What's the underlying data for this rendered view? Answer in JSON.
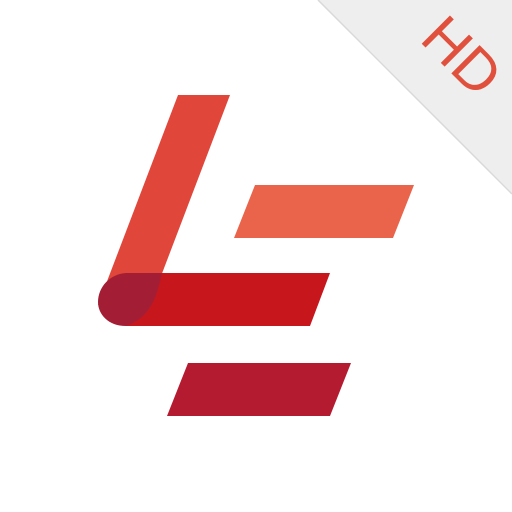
{
  "badge": {
    "label": "HD"
  },
  "colors": {
    "background": "#ffffff",
    "corner_fold": "#eeeeee",
    "fold_edge": "#d9d9d9",
    "badge_text": "#e0503c",
    "vertical_stroke": "#e0463a",
    "top_bar": "#ea644b",
    "middle_bar": "#c8161d",
    "bottom_bar": "#b51b30",
    "curl": "#a31e35"
  },
  "icons": {
    "logo": "le-letter-mark",
    "badge": "hd-corner-badge"
  }
}
